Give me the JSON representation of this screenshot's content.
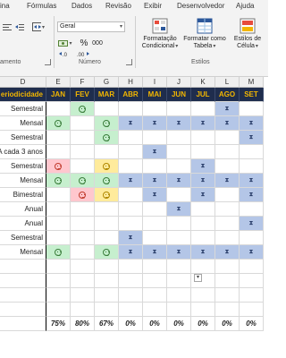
{
  "ribbon": {
    "tabs": [
      "ina",
      "Fórmulas",
      "Dados",
      "Revisão",
      "Exibir",
      "Desenvolvedor",
      "Ajuda"
    ],
    "groups": {
      "alignment": "amento",
      "number": "Número",
      "styles": "Estilos"
    },
    "number_format": "Geral",
    "percent_symbol": "%",
    "thousands_symbol": "000",
    "styles_buttons": [
      {
        "line1": "Formatação",
        "line2": "Condicional"
      },
      {
        "line1": "Formatar como",
        "line2": "Tabela"
      },
      {
        "line1": "Estilos de",
        "line2": "Célula"
      }
    ]
  },
  "sheet": {
    "column_letters": [
      "D",
      "E",
      "F",
      "G",
      "H",
      "I",
      "J",
      "K",
      "L",
      "M"
    ],
    "header_label": "eriodicidade",
    "months": [
      "JAN",
      "FEV",
      "MAR",
      "ABR",
      "MAI",
      "JUN",
      "JUL",
      "AGO",
      "SET"
    ],
    "rows": [
      {
        "label": "Semestral",
        "cells": [
          "",
          "G",
          "",
          "",
          "",
          "",
          "",
          "B",
          ""
        ]
      },
      {
        "label": "Mensal",
        "cells": [
          "G",
          "",
          "G",
          "B",
          "B",
          "B",
          "B",
          "B",
          "B"
        ]
      },
      {
        "label": "Semestral",
        "cells": [
          "",
          "",
          "G",
          "",
          "",
          "",
          "",
          "",
          "B"
        ]
      },
      {
        "label": "A cada 3 anos",
        "cells": [
          "",
          "",
          "",
          "",
          "B",
          "",
          "",
          "",
          ""
        ]
      },
      {
        "label": "Semestral",
        "cells": [
          "R",
          "",
          "Y",
          "",
          "",
          "",
          "B",
          "",
          ""
        ]
      },
      {
        "label": "Mensal",
        "cells": [
          "G",
          "G",
          "G",
          "B",
          "B",
          "B",
          "B",
          "B",
          "B"
        ]
      },
      {
        "label": "Bimestral",
        "cells": [
          "",
          "R",
          "Y",
          "",
          "B",
          "",
          "B",
          "",
          "B"
        ]
      },
      {
        "label": "Anual",
        "cells": [
          "",
          "",
          "",
          "",
          "",
          "B",
          "",
          "",
          ""
        ]
      },
      {
        "label": "Anual",
        "cells": [
          "",
          "",
          "",
          "",
          "",
          "",
          "",
          "",
          "B"
        ]
      },
      {
        "label": "Semestral",
        "cells": [
          "",
          "",
          "",
          "B",
          "",
          "",
          "",
          "",
          ""
        ]
      },
      {
        "label": "Mensal",
        "cells": [
          "G",
          "",
          "G",
          "B",
          "B",
          "B",
          "B",
          "B",
          "B"
        ]
      }
    ],
    "percentages": [
      "75%",
      "80%",
      "67%",
      "0%",
      "0%",
      "0%",
      "0%",
      "0%",
      "0%"
    ]
  },
  "colors": {
    "header_bg": "#1f2d4d",
    "header_text": "#f2b600",
    "good": "#c6efce",
    "bad": "#ffc7ce",
    "neutral": "#ffeb9c",
    "pending": "#b4c6e7"
  }
}
